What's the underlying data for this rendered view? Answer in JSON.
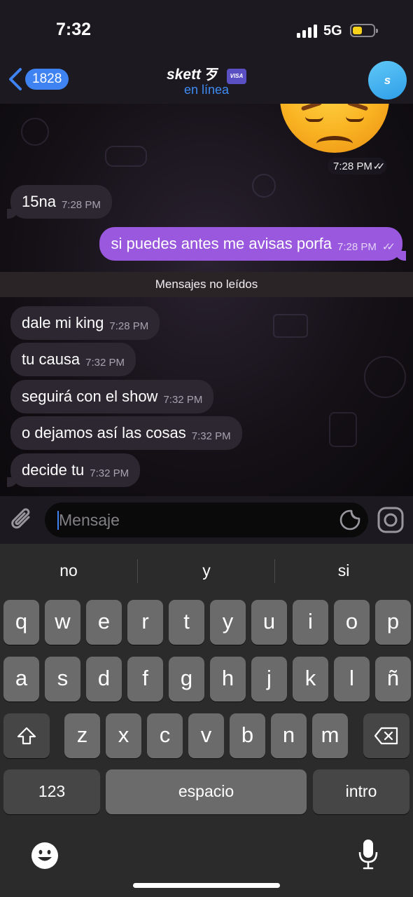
{
  "status_bar": {
    "time": "7:32",
    "network": "5G",
    "battery_level": 0.45,
    "signal_bars": 4
  },
  "header": {
    "back_count": "1828",
    "chat_name": "skett",
    "name_extra": "歹",
    "badge_text": "VISA",
    "status": "en línea",
    "avatar_initial": "s",
    "accent_color": "#3f83f3"
  },
  "messages": [
    {
      "kind": "sticker",
      "emoji": "😞",
      "time": "7:28 PM",
      "direction": "out"
    },
    {
      "kind": "text",
      "direction": "in",
      "text": "15na",
      "time": "7:28 PM"
    },
    {
      "kind": "text",
      "direction": "out",
      "text": "si puedes antes me avisas porfa",
      "time": "7:28 PM"
    },
    {
      "kind": "divider",
      "text": "Mensajes no leídos"
    },
    {
      "kind": "text",
      "direction": "in",
      "text": "dale mi king",
      "time": "7:28 PM"
    },
    {
      "kind": "text",
      "direction": "in",
      "text": "tu causa",
      "time": "7:32 PM"
    },
    {
      "kind": "text",
      "direction": "in",
      "text": "seguirá con el show",
      "time": "7:32 PM"
    },
    {
      "kind": "text",
      "direction": "in",
      "text": "o dejamos así las cosas",
      "time": "7:32 PM"
    },
    {
      "kind": "text",
      "direction": "in",
      "text": "decide tu",
      "time": "7:32 PM"
    }
  ],
  "input": {
    "placeholder": "Mensaje"
  },
  "keyboard": {
    "suggestions": [
      "no",
      "y",
      "si"
    ],
    "row1": [
      "q",
      "w",
      "e",
      "r",
      "t",
      "y",
      "u",
      "i",
      "o",
      "p"
    ],
    "row2": [
      "a",
      "s",
      "d",
      "f",
      "g",
      "h",
      "j",
      "k",
      "l",
      "ñ"
    ],
    "row3": [
      "z",
      "x",
      "c",
      "v",
      "b",
      "n",
      "m"
    ],
    "numbers_label": "123",
    "space_label": "espacio",
    "return_label": "intro"
  },
  "colors": {
    "outgoing_bubble": "#9a58de",
    "incoming_bubble": "#2c2731",
    "link": "#3f8cf5"
  }
}
